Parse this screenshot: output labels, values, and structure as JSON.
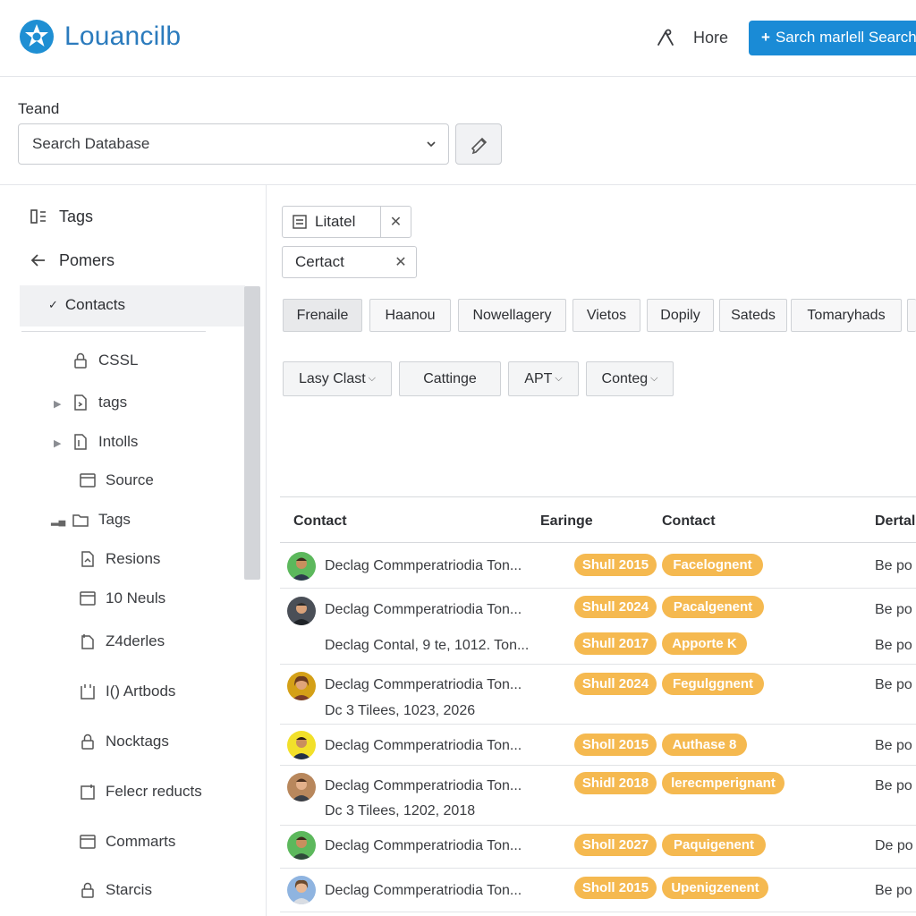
{
  "app": {
    "brand": "Louancilb"
  },
  "header": {
    "home_label": "Hore",
    "primary_button_label": "Sarch marlell Search"
  },
  "search": {
    "label": "Teand",
    "placeholder": "Search Database"
  },
  "sidebar": {
    "top_items": [
      {
        "label": "Tags",
        "icon": "panel-icon"
      },
      {
        "label": "Pomers",
        "icon": "arrow-left-icon"
      },
      {
        "label": "Contacts",
        "icon": "check-icon",
        "selected": true
      }
    ],
    "tree": [
      {
        "label": "CSSL",
        "icon": "lock-icon"
      },
      {
        "label": "tags",
        "icon": "file-icon",
        "expandable": true
      },
      {
        "label": "Intolls",
        "icon": "file-icon",
        "expandable": true
      },
      {
        "label": "Source",
        "icon": "folder-icon"
      },
      {
        "label": "Tags",
        "icon": "folder-icon",
        "signal": true
      },
      {
        "label": "Resions",
        "icon": "file-icon"
      },
      {
        "label": "10 Neuls",
        "icon": "folder-icon"
      },
      {
        "label": "Z4derles",
        "icon": "file-icon"
      },
      {
        "label": "I() Artbods",
        "icon": "folder-icon"
      },
      {
        "label": "Nocktags",
        "icon": "lock-icon"
      },
      {
        "label": "Felecr reducts",
        "icon": "file-icon"
      },
      {
        "label": "Commarts",
        "icon": "folder-icon"
      },
      {
        "label": "Starcis",
        "icon": "lock-icon"
      }
    ]
  },
  "chips": [
    {
      "label": "Litatel",
      "icon": "list-icon"
    },
    {
      "label": "Certact"
    }
  ],
  "tabs": [
    "Frenaile",
    "Haanou",
    "Nowellagery",
    "Vietos",
    "Dopily",
    "Sateds",
    "Tomaryhads"
  ],
  "filters": [
    {
      "label": "Lasy Clast",
      "dropdown": true
    },
    {
      "label": "Cattinge",
      "dropdown": false
    },
    {
      "label": "APT",
      "dropdown": true
    },
    {
      "label": "Conteg",
      "dropdown": true
    }
  ],
  "table": {
    "headers": [
      "Contact",
      "Earinge",
      "Contact",
      "Dertal"
    ],
    "rows": [
      {
        "avatar_color": "#5cb85c",
        "lines": [
          "Declag Commperatriodia Ton..."
        ],
        "badges": [
          [
            "Shull 2015",
            "Facelognent"
          ]
        ],
        "detail": [
          "Be po"
        ]
      },
      {
        "avatar_color": "#4a4f57",
        "lines": [
          "Declag Commperatriodia Ton...",
          "Declag Contal, 9  te,  1012. Ton..."
        ],
        "badges": [
          [
            "Shull 2024",
            "Pacalgenent"
          ],
          [
            "Shull 2017",
            "Apporte K"
          ]
        ],
        "detail": [
          "Be po",
          "Be po"
        ]
      },
      {
        "avatar_color": "#d4a017",
        "lines": [
          "Declag Commperatriodia Ton...",
          "Dc 3 Tilees, 1023, 2026"
        ],
        "badges": [
          [
            "Shull 2024",
            "Fegulggnent"
          ]
        ],
        "detail": [
          "Be po"
        ]
      },
      {
        "avatar_color": "#f2e02a",
        "lines": [
          "Declag Commperatriodia Ton..."
        ],
        "badges": [
          [
            "Sholl 2015",
            "Authase 8"
          ]
        ],
        "detail": [
          "Be po"
        ]
      },
      {
        "avatar_color": "#b8875c",
        "lines": [
          "Declag Commperatriodia Ton...",
          "Dc 3 Tilees, 1202, 2018"
        ],
        "badges": [
          [
            "Shidl 2018",
            "lerecmperignant"
          ]
        ],
        "detail": [
          "Be po"
        ]
      },
      {
        "avatar_color": "#5cb85c",
        "lines": [
          "Declag Commperatriodia Ton..."
        ],
        "badges": [
          [
            "Sholl 2027",
            "Paquigenent"
          ]
        ],
        "detail": [
          "De po"
        ]
      },
      {
        "avatar_color": "#8fb4e0",
        "lines": [
          "Declag Commperatriodia Ton..."
        ],
        "badges": [
          [
            "Sholl 2015",
            "Upenigzenent"
          ]
        ],
        "detail": [
          "Be po"
        ]
      }
    ]
  },
  "colors": {
    "accent": "#1a8bd6",
    "badge": "#f5b950",
    "brand_text": "#2b7bbd"
  }
}
